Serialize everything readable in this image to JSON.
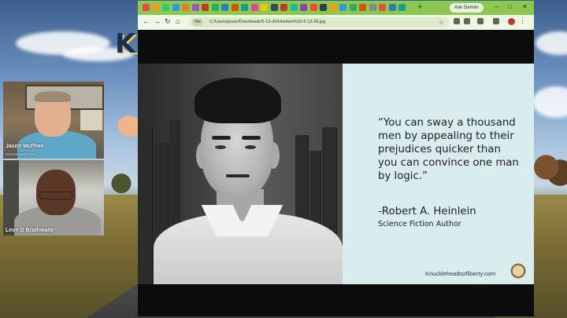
{
  "participants": [
    {
      "name": "Jason McPhee",
      "subtitle": "Knuckleheads Host"
    },
    {
      "name": "Leon D Brathwaite"
    }
  ],
  "browser": {
    "gemini_button": "Ask Gemini",
    "file_chip": "File",
    "url": "C:/Users/jason/Downloads/5-13-26/Heinlein%20-5-13-26.jpg",
    "tab_icon_colors": [
      "#e74c3c",
      "#f39c12",
      "#2ecc71",
      "#3498db",
      "#e67e22",
      "#9b59b6",
      "#c0392b",
      "#27ae60",
      "#2980b9",
      "#d35400",
      "#16a085",
      "#e84393",
      "#f1c40f",
      "#34495e",
      "#c0392b",
      "#1abc9c",
      "#8e44ad",
      "#e74c3c",
      "#2c3e50",
      "#f39c12",
      "#3498db",
      "#27ae60",
      "#d35400",
      "#7f8c8d",
      "#e74c3c",
      "#2980b9",
      "#16a085"
    ]
  },
  "slide": {
    "quote": "“You can sway a thousand men by appealing to their prejudices quicker than you can convince one man by logic.”",
    "author": "-Robert A. Heinlein",
    "author_title": "Science Fiction Author",
    "website": "Knuckleheadsofliberty.com"
  },
  "icons": {
    "tab_new": "plus-icon",
    "back": "arrow-left-icon",
    "forward": "arrow-right-icon",
    "reload": "reload-icon",
    "home": "home-icon",
    "bookmark": "star-icon",
    "menu": "more-vertical-icon"
  }
}
